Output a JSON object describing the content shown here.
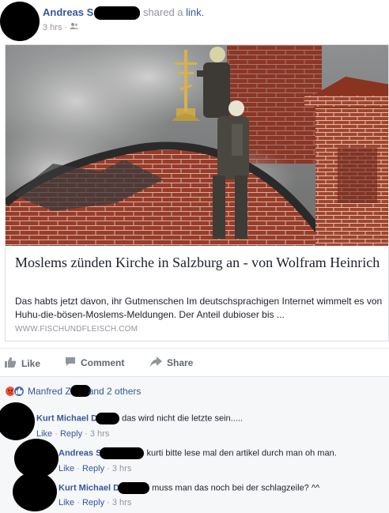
{
  "post": {
    "author": "Andreas S",
    "action_text": "shared a",
    "link_word": "link.",
    "time": "3 hrs",
    "separator": "·"
  },
  "link_card": {
    "title": "Moslems zünden Kirche in Salzburg an - von Wolfram Heinrich",
    "description": "Das habts jetzt davon, ihr Gutmenschen Im deutschsprachigen Internet wimmelt es von Huhu-die-bösen-Moslems-Meldungen. Der Anteil dubioser bis ...",
    "domain": "WWW.FISCHUNDFLEISCH.COM"
  },
  "actions": {
    "like": "Like",
    "comment": "Comment",
    "share": "Share"
  },
  "reactions": {
    "name_start": "Manfred Z",
    "rest": "and 2 others"
  },
  "comments": [
    {
      "author": "Kurt Michael D",
      "text": "das wird nicht die letzte sein.....",
      "like": "Like",
      "reply": "Reply",
      "time": "3 hrs"
    },
    {
      "author": "Andreas S",
      "text": "kurti bitte lese mal den artikel durch man oh man.",
      "like": "Like",
      "reply": "Reply",
      "time": "3 hrs"
    },
    {
      "author": "Kurt Michael D",
      "text": "muss man das noch bei der schlagzeile? ^^",
      "like": "Like",
      "reply": "Reply",
      "time": "3 hrs"
    }
  ],
  "colors": {
    "link_blue": "#365899",
    "meta_grey": "#90949c",
    "angry_orange": "#f0533a",
    "like_blue": "#4267b2"
  },
  "icons": {
    "audience": "friends-icon",
    "like": "thumbs-up-icon",
    "comment": "speech-bubble-icon",
    "share": "share-arrow-icon"
  }
}
